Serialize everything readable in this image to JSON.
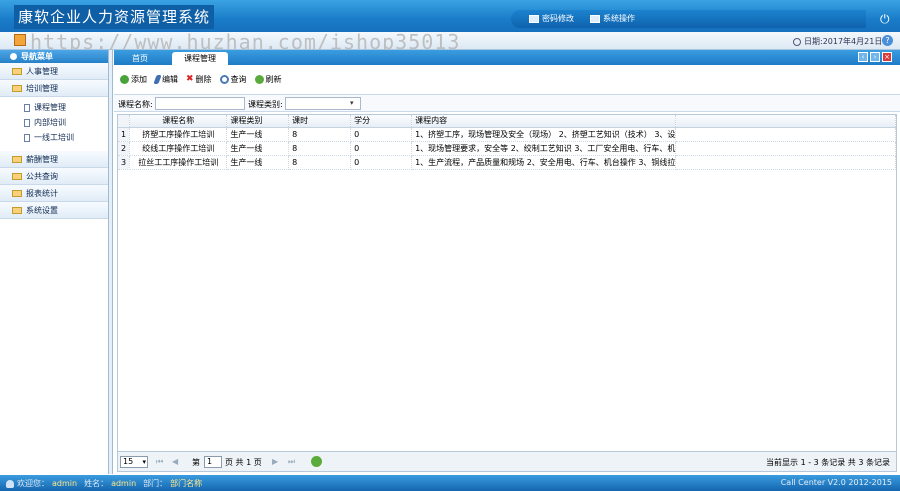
{
  "header": {
    "app_title": "康软企业人力资源管理系统",
    "password_label": "密码修改",
    "system_ops_label": "系统操作"
  },
  "infobar": {
    "watermark": "https://www.huzhan.com/ishop35013",
    "date_text": "日期:2017年4月21日"
  },
  "sidebar": {
    "title": "导航菜单",
    "groups": [
      {
        "label": "人事管理"
      },
      {
        "label": "培训管理"
      },
      {
        "label": "薪酬管理"
      },
      {
        "label": "公共查询"
      },
      {
        "label": "报表统计"
      },
      {
        "label": "系统设置"
      }
    ],
    "training_items": [
      {
        "label": "课程管理"
      },
      {
        "label": "内部培训"
      },
      {
        "label": "一线工培训"
      }
    ]
  },
  "tabs": [
    {
      "label": "首页"
    },
    {
      "label": "课程管理"
    }
  ],
  "toolbar": {
    "add": "添加",
    "edit": "编辑",
    "delete": "删除",
    "query": "查询",
    "refresh": "刷新"
  },
  "search": {
    "name_label": "课程名称:",
    "name_value": "",
    "category_label": "课程类别:",
    "category_value": ""
  },
  "grid": {
    "columns": [
      "课程名称",
      "课程类别",
      "课时",
      "学分",
      "课程内容"
    ],
    "rows": [
      {
        "n": "1",
        "name": "挤塑工序操作工培训",
        "category": "生产一线",
        "hours": "8",
        "credit": "0",
        "content": "1、挤塑工序，现场管理及安全（现场） 2、挤塑工艺知识（技术） 3、设"
      },
      {
        "n": "2",
        "name": "绞线工序操作工培训",
        "category": "生产一线",
        "hours": "8",
        "credit": "0",
        "content": "1、现场管理要求，安全等 2、绞制工艺知识 3、工厂安全用电、行车、机"
      },
      {
        "n": "3",
        "name": "拉丝工工序操作工培训",
        "category": "生产一线",
        "hours": "8",
        "credit": "0",
        "content": "1、生产流程，产品质量和规场 2、安全用电、行车、机台操作 3、铜线拉"
      }
    ]
  },
  "pager": {
    "page_size": "15",
    "page_prefix": "第",
    "page_value": "1",
    "page_suffix": "页 共 1 页",
    "info": "当前显示 1 - 3 条记录 共 3 条记录"
  },
  "footer": {
    "welcome": "欢迎您：",
    "user": "admin",
    "name_label": "姓名：",
    "name": "admin",
    "dept_label": "部门：",
    "dept": "部门名称",
    "copyright": "Call Center V2.0 2012-2015"
  },
  "colors": {
    "primary": "#1e7bc6",
    "header_dark": "#0e5fa6"
  }
}
